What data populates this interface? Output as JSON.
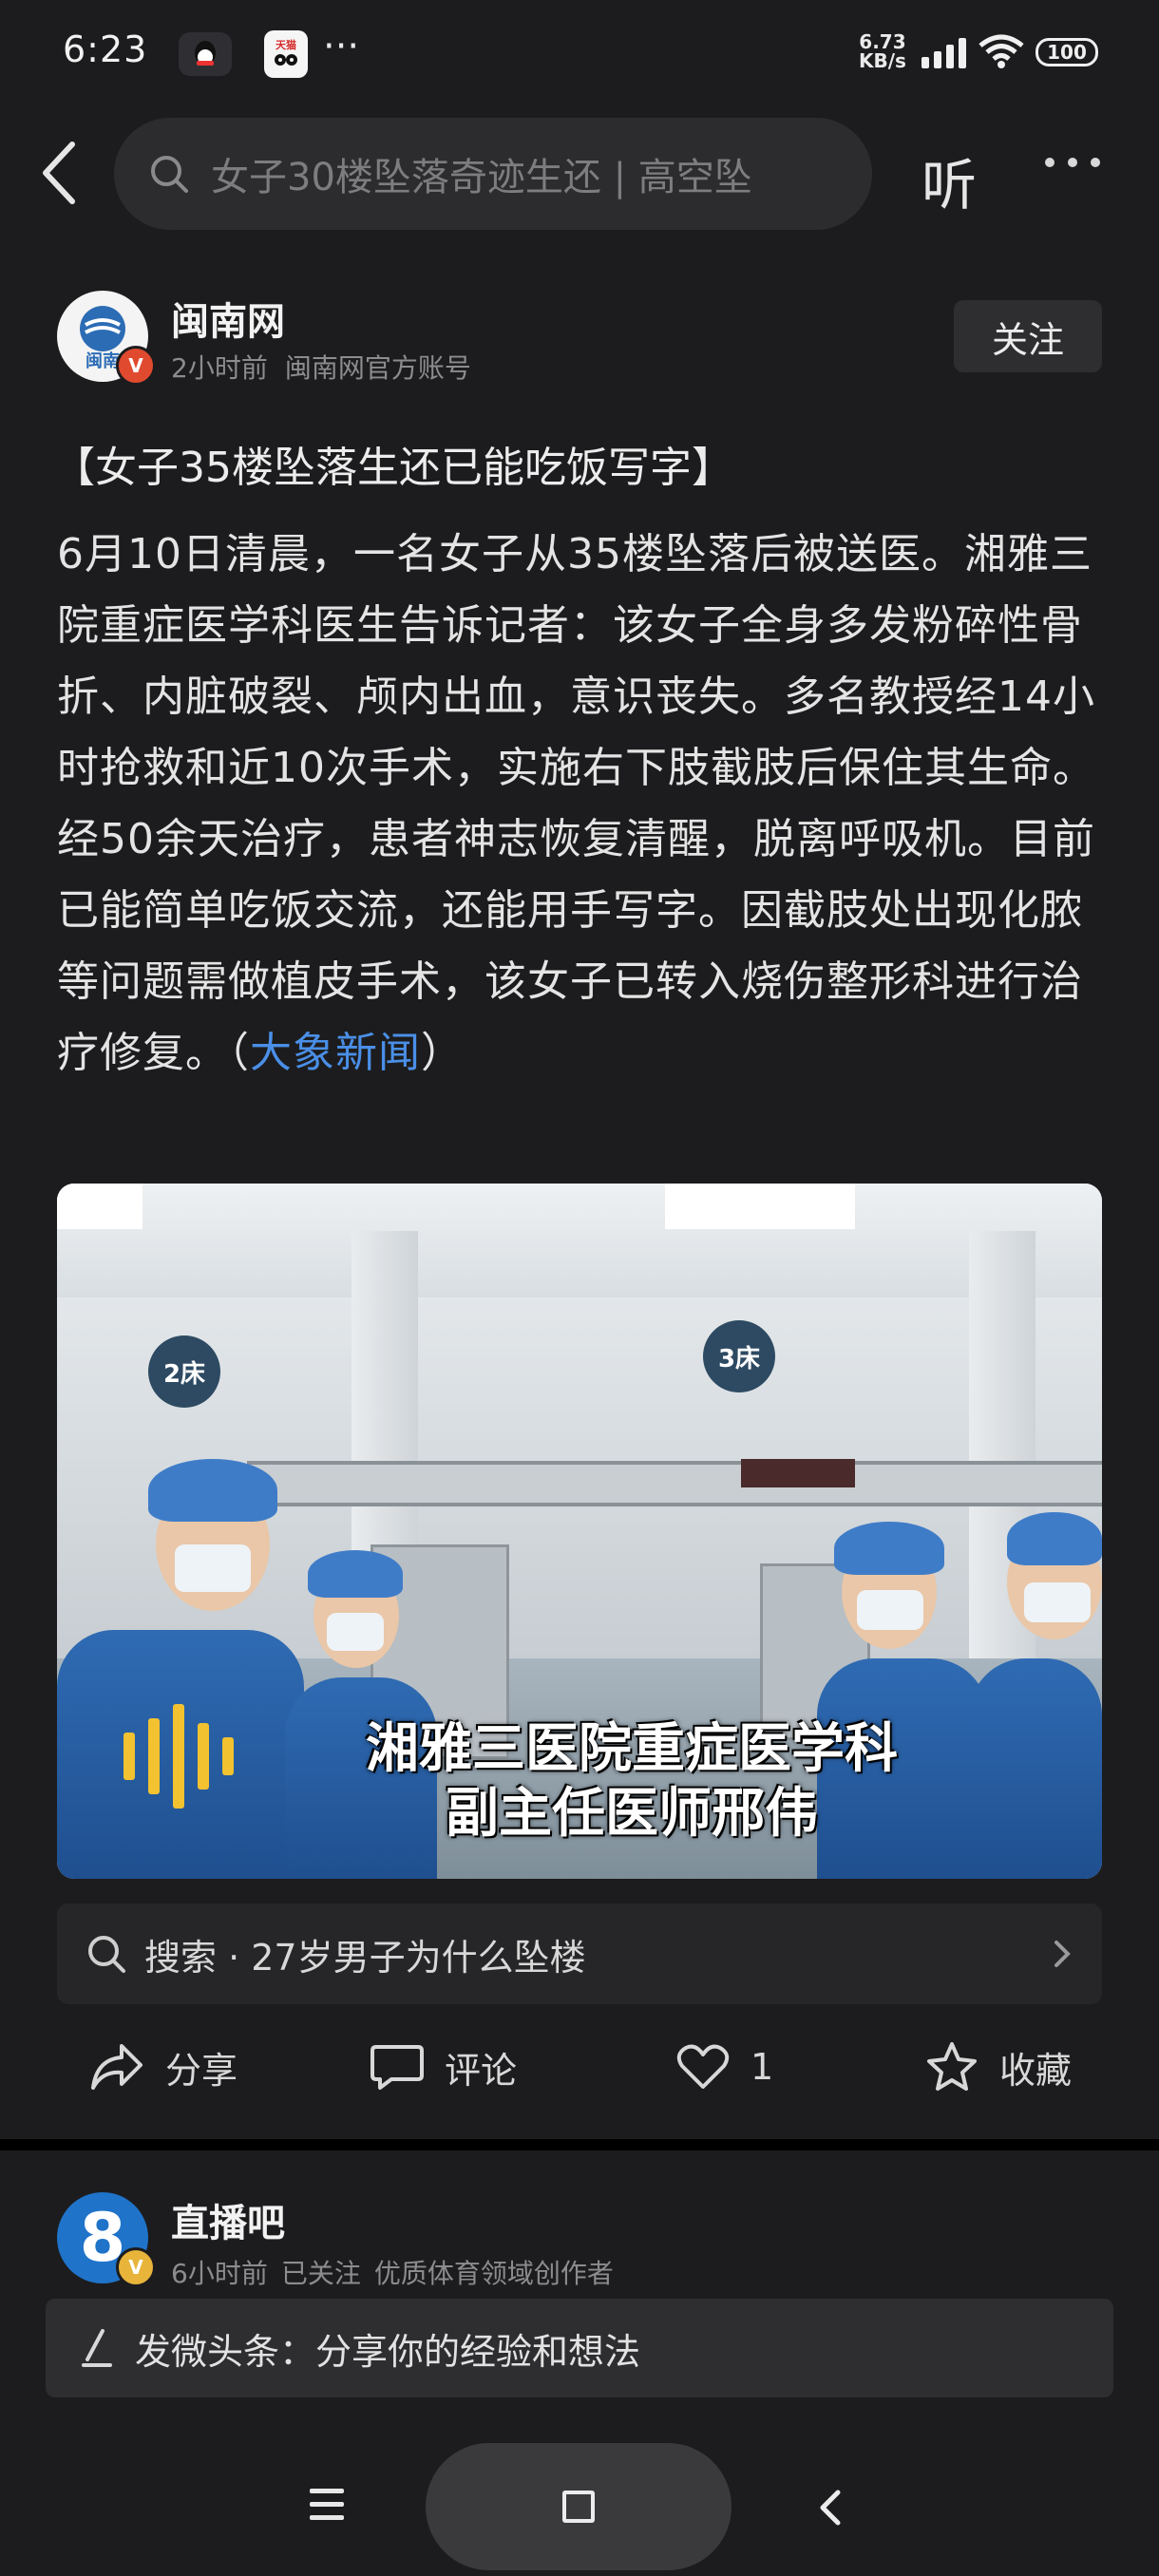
{
  "status_bar": {
    "time": "6:23",
    "app2_label": "天猫",
    "more": "···",
    "net_speed_value": "6.73",
    "net_speed_unit": "KB/s",
    "battery": "100"
  },
  "top_bar": {
    "search_query": "女子30楼坠落奇迹生还 | 高空坠",
    "listen_label": "听"
  },
  "author": {
    "name": "闽南网",
    "time": "2小时前",
    "desc": "闽南网官方账号",
    "badge": "V",
    "avatar_text": "闽南",
    "follow_label": "关注"
  },
  "post": {
    "title": "【女子35楼坠落生还已能吃饭写字】",
    "body": "6月10日清晨，一名女子从35楼坠落后被送医。湘雅三院重症医学科医生告诉记者：该女子全身多发粉碎性骨折、内脏破裂、颅内出血，意识丧失。多名教授经14小时抢救和近10次手术，实施右下肢截肢后保住其生命。经50余天治疗，患者神志恢复清醒，脱离呼吸机。目前已能简单吃饭交流，还能用手写字。因截肢处出现化脓等问题需做植皮手术，该女子已转入烧伤整形科进行治疗修复。（",
    "source_link": "大象新闻",
    "close_paren": "）"
  },
  "video": {
    "bed2": "2床",
    "bed3": "3床",
    "caption_line1": "湘雅三医院重症医学科",
    "caption_line2": "副主任医师邢伟"
  },
  "related_search": {
    "text": "搜索 · 27岁男子为什么坠楼"
  },
  "actions": {
    "share": "分享",
    "comment": "评论",
    "like_count": "1",
    "favorite": "收藏"
  },
  "next_post": {
    "name": "直播吧",
    "avatar_text": "8",
    "badge": "V",
    "time": "6小时前",
    "followed": "已关注",
    "desc": "优质体育领域创作者"
  },
  "composer": {
    "placeholder": "发微头条：分享你的经验和想法"
  }
}
